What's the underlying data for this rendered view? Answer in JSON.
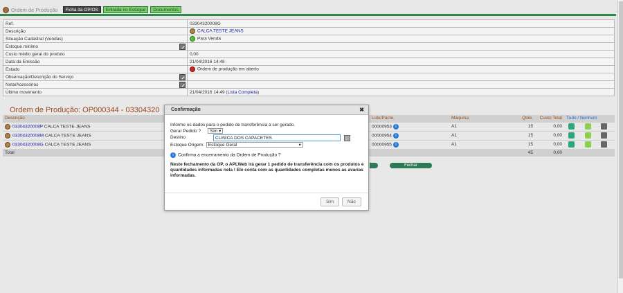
{
  "header": {
    "title": "Ordem de Produção",
    "tabs": [
      "Ficha da OP/OS",
      "Entrada no Estoque",
      "Documentos"
    ]
  },
  "props": [
    {
      "label": "Ref.",
      "value": "03304320008G"
    },
    {
      "label": "Descrição",
      "value": "CALCA TESTE JEANS"
    },
    {
      "label": "Situação Cadastral (Vendas)",
      "value": "Para Venda"
    },
    {
      "label": "Estoque mínimo",
      "value": ""
    },
    {
      "label": "Custo médio geral do produto",
      "value": "0,00"
    },
    {
      "label": "Data da Emissão",
      "value": "21/04/2016 14:48"
    },
    {
      "label": "Estado",
      "value": "Ordem de produção em aberto"
    },
    {
      "label": "Observação/Descrição do Serviço",
      "value": ""
    },
    {
      "label": "Nota/Acessórios",
      "value": ""
    },
    {
      "label": "Último movimento",
      "value_date": "21/04/2016 14:49 (",
      "value_link": "Lista Completa",
      "value_end": ")"
    }
  ],
  "section_title": "Ordem de Produção: OP000344 - 03304320",
  "grid": {
    "headers": {
      "desc": "Descrição",
      "lote": "Lote/Pacte.",
      "maquina": "Máquina",
      "qtde": "Qtde.",
      "custo": "Custo Total",
      "tudo": "Tudo / Nenhum"
    },
    "rows": [
      {
        "ref": "03304320008P",
        "desc": "CALCA TESTE JEANS",
        "lote": "00000953",
        "maquina": "A1",
        "qtde": "15",
        "custo": "0,00"
      },
      {
        "ref": "03304320008M",
        "desc": "CALCA TESTE JEANS",
        "lote": "00000954",
        "maquina": "A1",
        "qtde": "15",
        "custo": "0,00"
      },
      {
        "ref": "03304320008G",
        "desc": "CALCA TESTE JEANS",
        "lote": "00000955",
        "maquina": "A1",
        "qtde": "15",
        "custo": "0,00"
      }
    ],
    "total_label": "Total",
    "total_qtde": "45",
    "total_custo": "0,00"
  },
  "fechar_label": "Fechar",
  "dialog": {
    "title": "Confirmação",
    "close": "✖",
    "intro": "Informe os dados para o pedido de transferência a ser gerado.",
    "gerar_label": "Gerar Pedido ?",
    "gerar_value": "Sim",
    "destino_label": "Destino",
    "destino_value": "CLINICA DOS CAPACETES",
    "estoque_label": "Estoque Origem:",
    "estoque_value": "Estoque Geral",
    "confirm_text": "Confirma a encerramento da Ordem de Produção ?",
    "note": "Neste fechamento da OP, o APLWeb irá gerar 1 pedido de transferência com os produtos e quantidades informadas nela ! Ele conta com as quantidades completas menos as avarias informadas.",
    "btn_sim": "Sim",
    "btn_nao": "Não"
  }
}
